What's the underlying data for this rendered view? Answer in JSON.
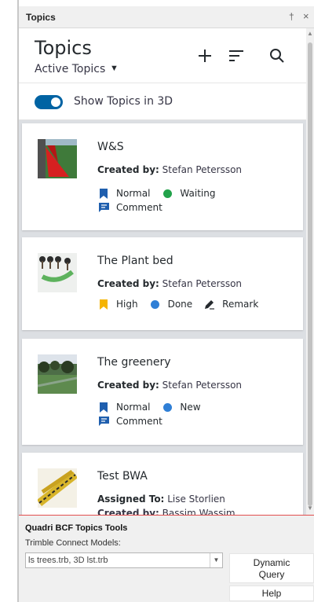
{
  "window": {
    "title": "Topics",
    "pin_glyph": "†",
    "close_glyph": "×"
  },
  "header": {
    "title": "Topics",
    "subtitle": "Active Topics",
    "add_icon": "plus-icon",
    "sort_icon": "sort-icon",
    "search_icon": "search-icon"
  },
  "toggle": {
    "label": "Show Topics in 3D",
    "on": true,
    "color": "#0063a3"
  },
  "status_colors": {
    "waiting": "#22a24a",
    "done": "#2f7fd6",
    "new": "#2f7fd6",
    "priority_normal": "#1f5fae",
    "priority_high": "#f5b400"
  },
  "topics": [
    {
      "title": "W&S",
      "meta_label": "Created by:",
      "meta_value": "Stefan Petersson",
      "priority": "Normal",
      "status": "Waiting",
      "type": "Comment"
    },
    {
      "title": "The Plant bed",
      "meta_label": "Created by:",
      "meta_value": "Stefan Petersson",
      "priority": "High",
      "status": "Done",
      "type": "Remark"
    },
    {
      "title": "The greenery",
      "meta_label": "Created by:",
      "meta_value": "Stefan Petersson",
      "priority": "Normal",
      "status": "New",
      "type": "Comment"
    },
    {
      "title": "Test BWA",
      "meta_label": "Assigned To:",
      "meta_value": "Lise Storlien",
      "meta2_label": "Created by:",
      "meta2_value": "Bassim Wassim"
    }
  ],
  "tools": {
    "title": "Quadri BCF Topics Tools",
    "models_label": "Trimble Connect Models:",
    "models_value": "ls trees.trb, 3D lst.trb",
    "dynamic_query_line1": "Dynamic",
    "dynamic_query_line2": "Query",
    "help_label": "Help"
  }
}
